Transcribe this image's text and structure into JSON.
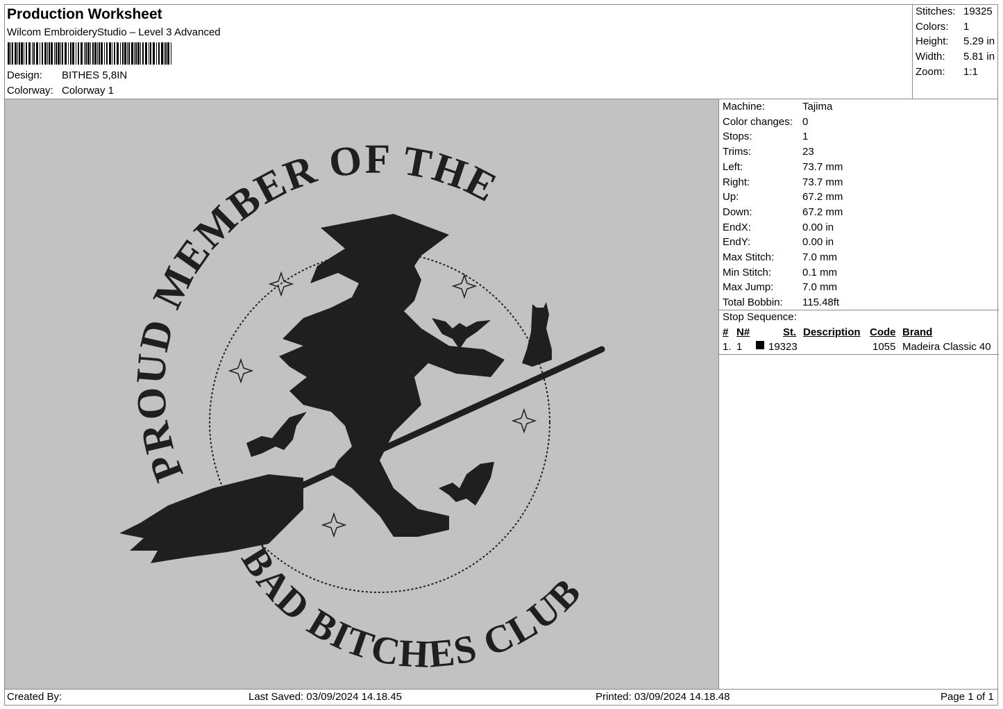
{
  "header": {
    "title": "Production Worksheet",
    "software": "Wilcom EmbroideryStudio – Level 3 Advanced",
    "design_label": "Design:",
    "design_value": "BITHES 5,8IN",
    "colorway_label": "Colorway:",
    "colorway_value": "Colorway 1"
  },
  "stats": [
    {
      "label": "Stitches:",
      "value": "19325"
    },
    {
      "label": "Colors:",
      "value": "1"
    },
    {
      "label": "Height:",
      "value": "5.29 in"
    },
    {
      "label": "Width:",
      "value": "5.81 in"
    },
    {
      "label": "Zoom:",
      "value": "1:1"
    }
  ],
  "machine": [
    {
      "label": "Machine:",
      "value": "Tajima"
    },
    {
      "label": "Color changes:",
      "value": "0"
    },
    {
      "label": "Stops:",
      "value": "1"
    },
    {
      "label": "Trims:",
      "value": "23"
    },
    {
      "label": "Left:",
      "value": "73.7 mm"
    },
    {
      "label": "Right:",
      "value": "73.7 mm"
    },
    {
      "label": "Up:",
      "value": "67.2 mm"
    },
    {
      "label": "Down:",
      "value": "67.2 mm"
    },
    {
      "label": "EndX:",
      "value": "0.00 in"
    },
    {
      "label": "EndY:",
      "value": "0.00 in"
    },
    {
      "label": "Max Stitch:",
      "value": "7.0 mm"
    },
    {
      "label": "Min Stitch:",
      "value": "0.1 mm"
    },
    {
      "label": "Max Jump:",
      "value": "7.0 mm"
    },
    {
      "label": "Total Bobbin:",
      "value": "115.48ft"
    }
  ],
  "stop_sequence": {
    "title": "Stop Sequence:",
    "columns": [
      "#",
      "N#",
      "St.",
      "Description",
      "Code",
      "Brand"
    ],
    "rows": [
      {
        "num": "1.",
        "n": "1",
        "color": "#000000",
        "stitches": "19323",
        "description": "",
        "code": "1055",
        "brand": "Madeira Classic 40"
      }
    ]
  },
  "design_text": {
    "top": "PROUD MEMBER OF THE",
    "bottom": "BAD BITCHES CLUB"
  },
  "colors": {
    "canvas_bg": "#c2c2c2",
    "thread": "#1f1f1f",
    "border": "#8a8a8a"
  },
  "footer": {
    "created_by": "Created By:",
    "last_saved": "Last Saved: 03/09/2024 14.18.45",
    "printed": "Printed: 03/09/2024 14.18.48",
    "page": "Page 1 of 1"
  }
}
